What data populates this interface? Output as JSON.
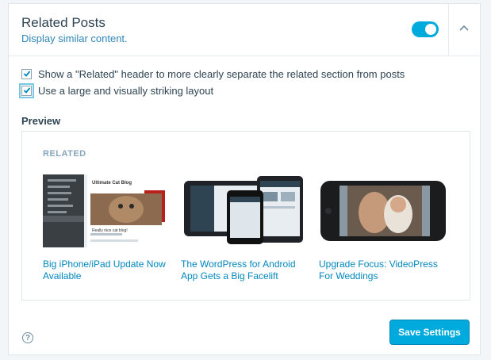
{
  "module": {
    "title": "Related Posts",
    "subtitle": "Display similar content.",
    "enabled": true
  },
  "options": [
    {
      "label": "Show a \"Related\" header to more clearly separate the related section from posts",
      "checked": true
    },
    {
      "label": "Use a large and visually striking layout",
      "checked": true
    }
  ],
  "preview": {
    "label": "Preview",
    "header": "RELATED",
    "posts": [
      {
        "title": "Big iPhone/iPad Update Now Available",
        "thumb_caption": "Ultimate Cat Blog",
        "thumb_caption2": "Really nice cat blog!"
      },
      {
        "title": "The WordPress for Android App Gets a Big Facelift"
      },
      {
        "title": "Upgrade Focus: VideoPress For Weddings"
      }
    ]
  },
  "footer": {
    "save_label": "Save Settings",
    "help_glyph": "?"
  },
  "colors": {
    "accent": "#00aadc",
    "link": "#0087be"
  }
}
